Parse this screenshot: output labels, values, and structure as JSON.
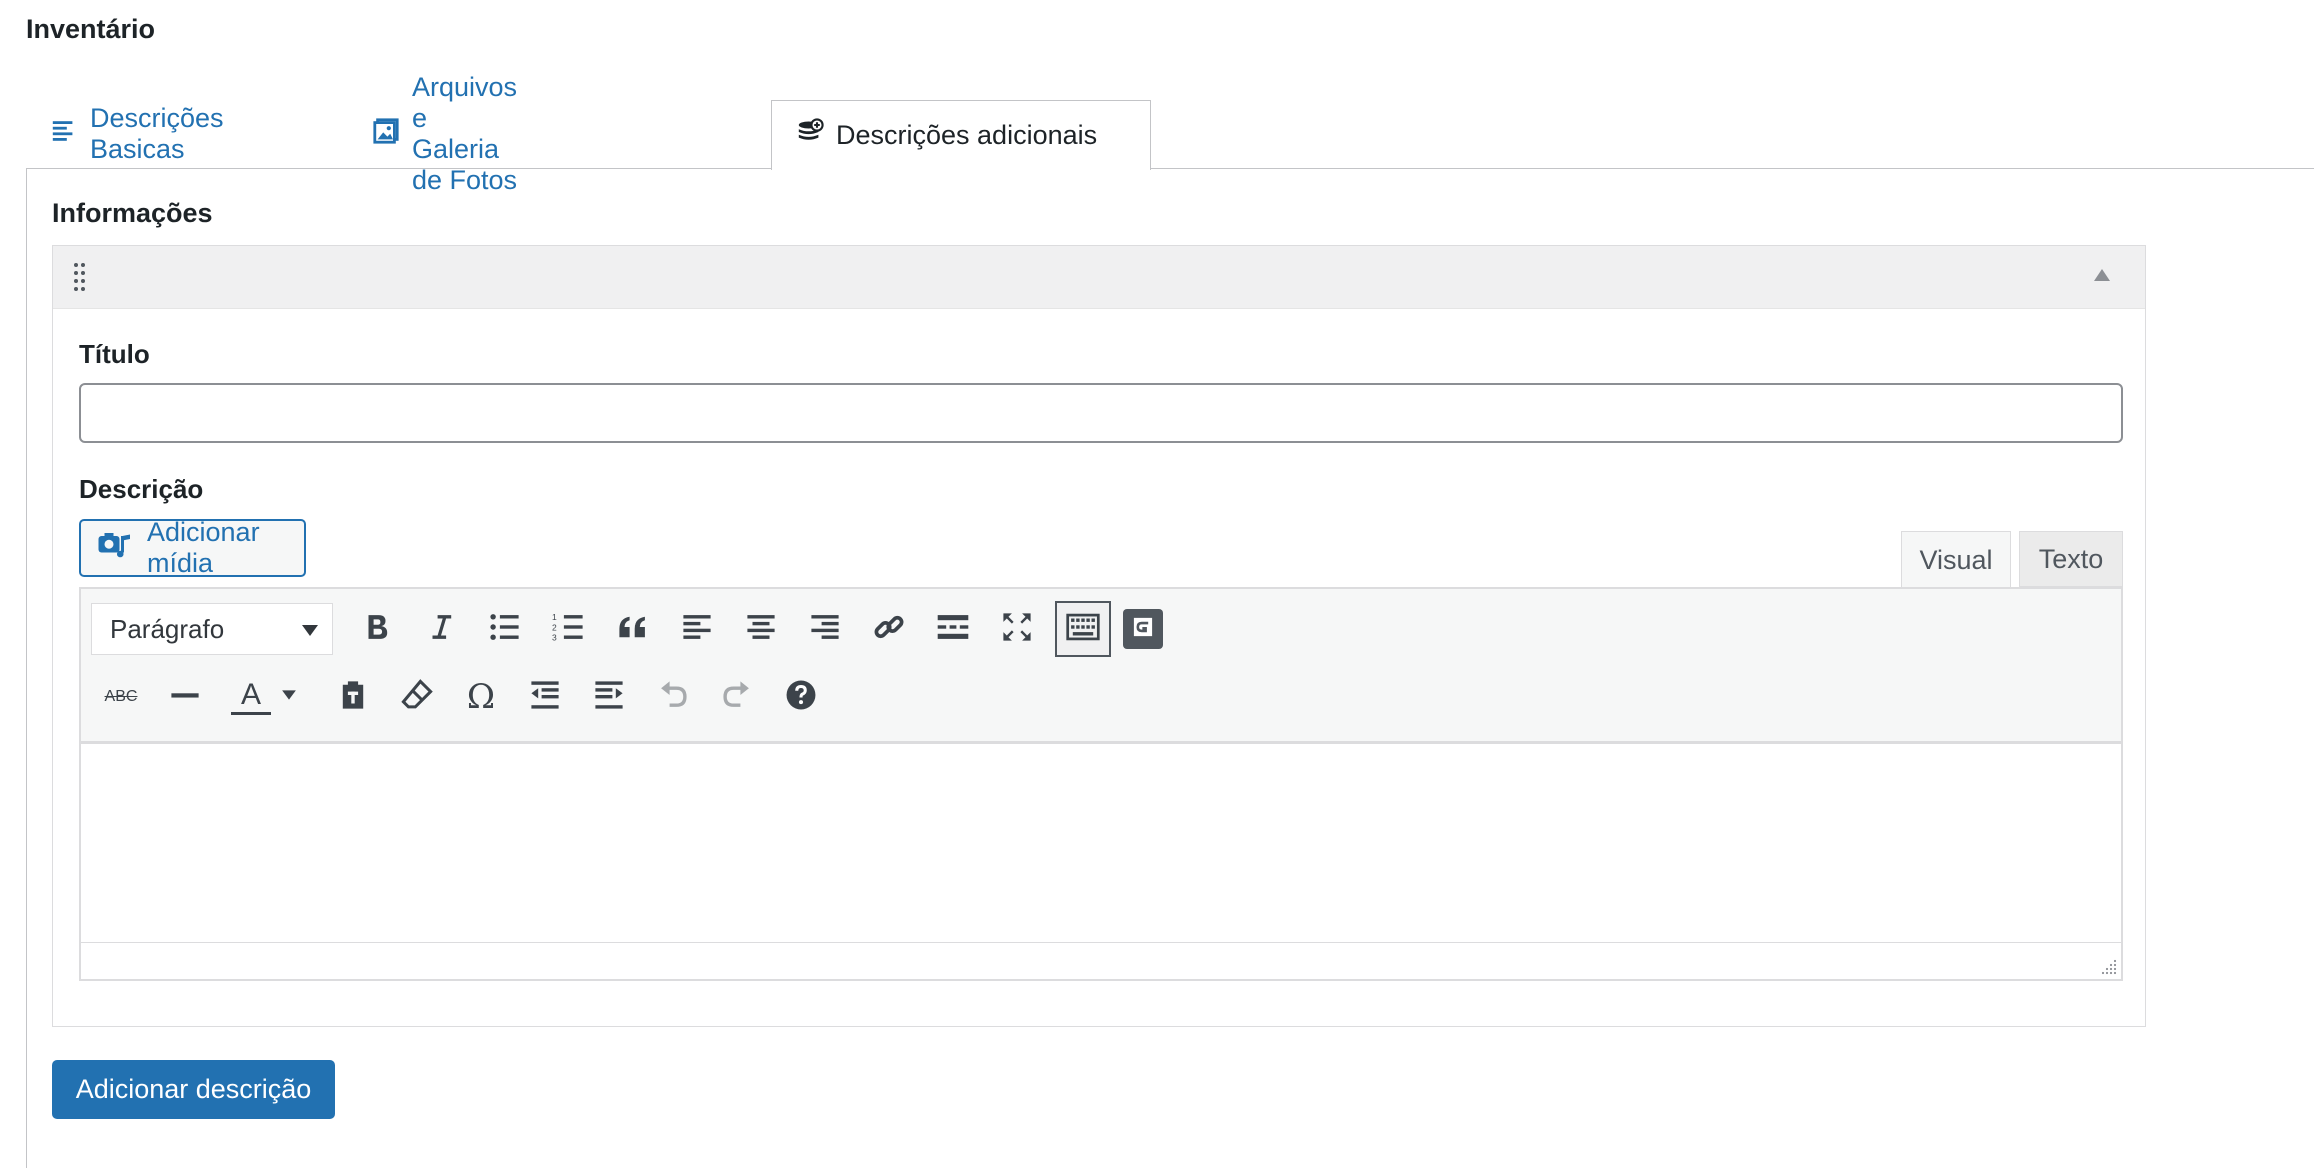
{
  "section": {
    "title": "Inventário"
  },
  "tabs": [
    {
      "label": "Descrições Basicas",
      "icon": "align-left-icon"
    },
    {
      "label": "Arquivos e Galeria de Fotos",
      "icon": "gallery-icon"
    },
    {
      "label": "Descrições adicionais",
      "icon": "database-add-icon",
      "active": true
    }
  ],
  "panel": {
    "label": "Informações",
    "titulo_label": "Título",
    "titulo_value": "",
    "descricao_label": "Descrição"
  },
  "media": {
    "button_label": "Adicionar mídia"
  },
  "editor": {
    "modes": {
      "visual": "Visual",
      "texto": "Texto",
      "active": "Visual"
    },
    "format_select": "Parágrafo",
    "row1_icons": [
      "bold-icon",
      "italic-icon",
      "bullet-list-icon",
      "numbered-list-icon",
      "blockquote-icon",
      "align-left-icon",
      "align-center-icon",
      "align-right-icon",
      "link-icon",
      "read-more-icon",
      "fullscreen-icon",
      "toolbar-toggle-icon",
      "gravity-form-icon"
    ],
    "row2_icons": [
      "strikethrough-icon",
      "horizontal-line-icon",
      "text-color-icon",
      "paste-text-icon",
      "clear-formatting-icon",
      "special-character-icon",
      "outdent-icon",
      "indent-icon",
      "undo-icon",
      "redo-icon",
      "help-icon"
    ],
    "strikethrough_text": "ABC",
    "text_color_letter": "A",
    "omega_glyph": "Ω"
  },
  "actions": {
    "add_description": "Adicionar descrição"
  },
  "colors": {
    "accent": "#2271b1",
    "border": "#c3c4c7",
    "toolbar_bg": "#f6f7f7"
  }
}
